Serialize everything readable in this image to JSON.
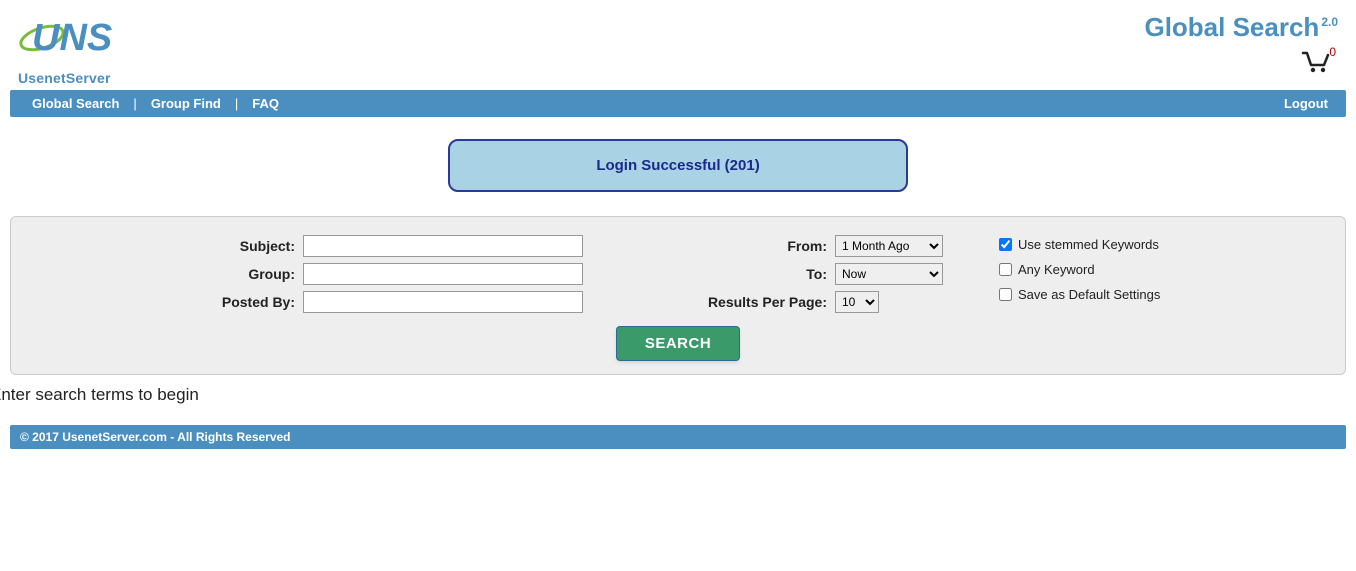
{
  "logo": {
    "subtext": "UsenetServer"
  },
  "title": {
    "main": "Global Search",
    "version": "2.0"
  },
  "cart": {
    "count": "0"
  },
  "nav": {
    "global_search": "Global Search",
    "group_find": "Group Find",
    "faq": "FAQ",
    "logout": "Logout"
  },
  "banner": {
    "message": "Login Successful (201)"
  },
  "form": {
    "labels": {
      "subject": "Subject:",
      "group": "Group:",
      "posted_by": "Posted By:",
      "from": "From:",
      "to": "To:",
      "rpp": "Results Per Page:"
    },
    "values": {
      "subject": "",
      "group": "",
      "posted_by": "",
      "from": "1 Month Ago",
      "to": "Now",
      "rpp": "10"
    },
    "checks": {
      "stemmed": {
        "label": "Use stemmed Keywords",
        "checked": true
      },
      "any": {
        "label": "Any Keyword",
        "checked": false
      },
      "save_default": {
        "label": "Save as Default Settings",
        "checked": false
      }
    },
    "search_button": "SEARCH"
  },
  "prompt": "Enter search terms to begin",
  "footer": "© 2017 UsenetServer.com - All Rights Reserved"
}
